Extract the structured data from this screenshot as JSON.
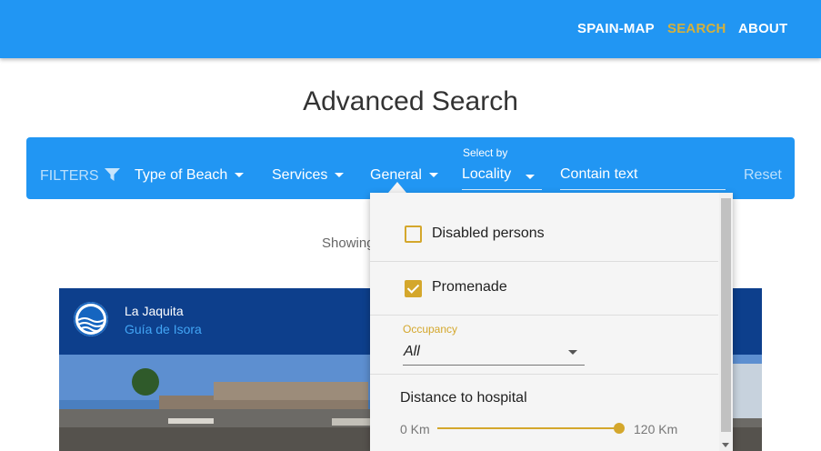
{
  "header": {
    "nav": [
      {
        "label": "SPAIN-MAP",
        "active": false
      },
      {
        "label": "SEARCH",
        "active": true
      },
      {
        "label": "ABOUT",
        "active": false
      }
    ],
    "brand_color": "#2196f3",
    "active_color": "#d4b03c"
  },
  "page": {
    "title": "Advanced Search"
  },
  "filterbar": {
    "filters_label": "FILTERS",
    "filter_icon": "filter-icon",
    "type_of_beach": "Type of Beach",
    "services": "Services",
    "general": "General",
    "select_by_label": "Select by",
    "select_by_value": "Locality",
    "contain_text": "Contain text",
    "reset": "Reset"
  },
  "results": {
    "showing_text": "Showing"
  },
  "card": {
    "title": "La Jaquita",
    "subtitle": "Guía de Isora",
    "icon": "blue-flag-icon"
  },
  "general_dropdown": {
    "disabled_persons": {
      "label": "Disabled persons",
      "checked": false
    },
    "promenade": {
      "label": "Promenade",
      "checked": true
    },
    "occupancy": {
      "label": "Occupancy",
      "value": "All"
    },
    "distance": {
      "label": "Distance to hospital",
      "min": "0 Km",
      "max": "120 Km",
      "value_fraction": 1.0
    },
    "accent_color": "#d4a72c"
  }
}
